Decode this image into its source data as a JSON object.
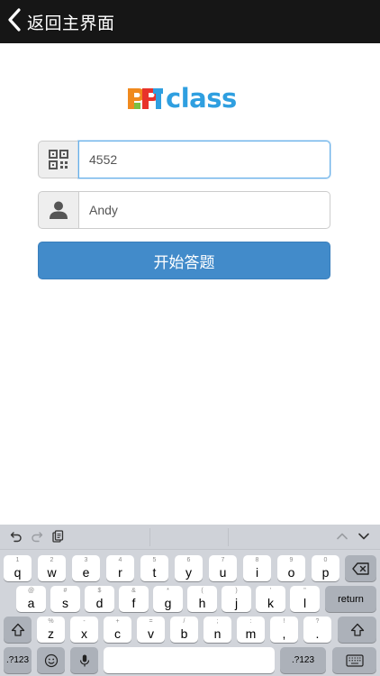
{
  "header": {
    "back_label": "返回主界面"
  },
  "logo": {
    "text": "class"
  },
  "form": {
    "code_value": "4552",
    "name_value": "Andy",
    "start_label": "开始答题"
  },
  "keyboard": {
    "rows": [
      [
        {
          "name": "key-q",
          "hint": "1",
          "main": "q"
        },
        {
          "name": "key-w",
          "hint": "2",
          "main": "w"
        },
        {
          "name": "key-e",
          "hint": "3",
          "main": "e"
        },
        {
          "name": "key-r",
          "hint": "4",
          "main": "r"
        },
        {
          "name": "key-t",
          "hint": "5",
          "main": "t"
        },
        {
          "name": "key-y",
          "hint": "6",
          "main": "y"
        },
        {
          "name": "key-u",
          "hint": "7",
          "main": "u"
        },
        {
          "name": "key-i",
          "hint": "8",
          "main": "i"
        },
        {
          "name": "key-o",
          "hint": "9",
          "main": "o"
        },
        {
          "name": "key-p",
          "hint": "0",
          "main": "p"
        }
      ],
      [
        {
          "name": "key-a",
          "hint": "@",
          "main": "a"
        },
        {
          "name": "key-s",
          "hint": "#",
          "main": "s"
        },
        {
          "name": "key-d",
          "hint": "$",
          "main": "d"
        },
        {
          "name": "key-f",
          "hint": "&",
          "main": "f"
        },
        {
          "name": "key-g",
          "hint": "*",
          "main": "g"
        },
        {
          "name": "key-h",
          "hint": "(",
          "main": "h"
        },
        {
          "name": "key-j",
          "hint": ")",
          "main": "j"
        },
        {
          "name": "key-k",
          "hint": "'",
          "main": "k"
        },
        {
          "name": "key-l",
          "hint": "\"",
          "main": "l"
        }
      ],
      [
        {
          "name": "key-z",
          "hint": "%",
          "main": "z"
        },
        {
          "name": "key-x",
          "hint": "-",
          "main": "x"
        },
        {
          "name": "key-c",
          "hint": "+",
          "main": "c"
        },
        {
          "name": "key-v",
          "hint": "=",
          "main": "v"
        },
        {
          "name": "key-b",
          "hint": "/",
          "main": "b"
        },
        {
          "name": "key-n",
          "hint": ";",
          "main": "n"
        },
        {
          "name": "key-m",
          "hint": ":",
          "main": "m"
        },
        {
          "name": "key-exclaim",
          "hint": "!",
          "main": ","
        },
        {
          "name": "key-question",
          "hint": "?",
          "main": "."
        }
      ]
    ],
    "return_label": "return",
    "numbers_label": ".?123",
    "numbers_label_right": ".?123"
  }
}
